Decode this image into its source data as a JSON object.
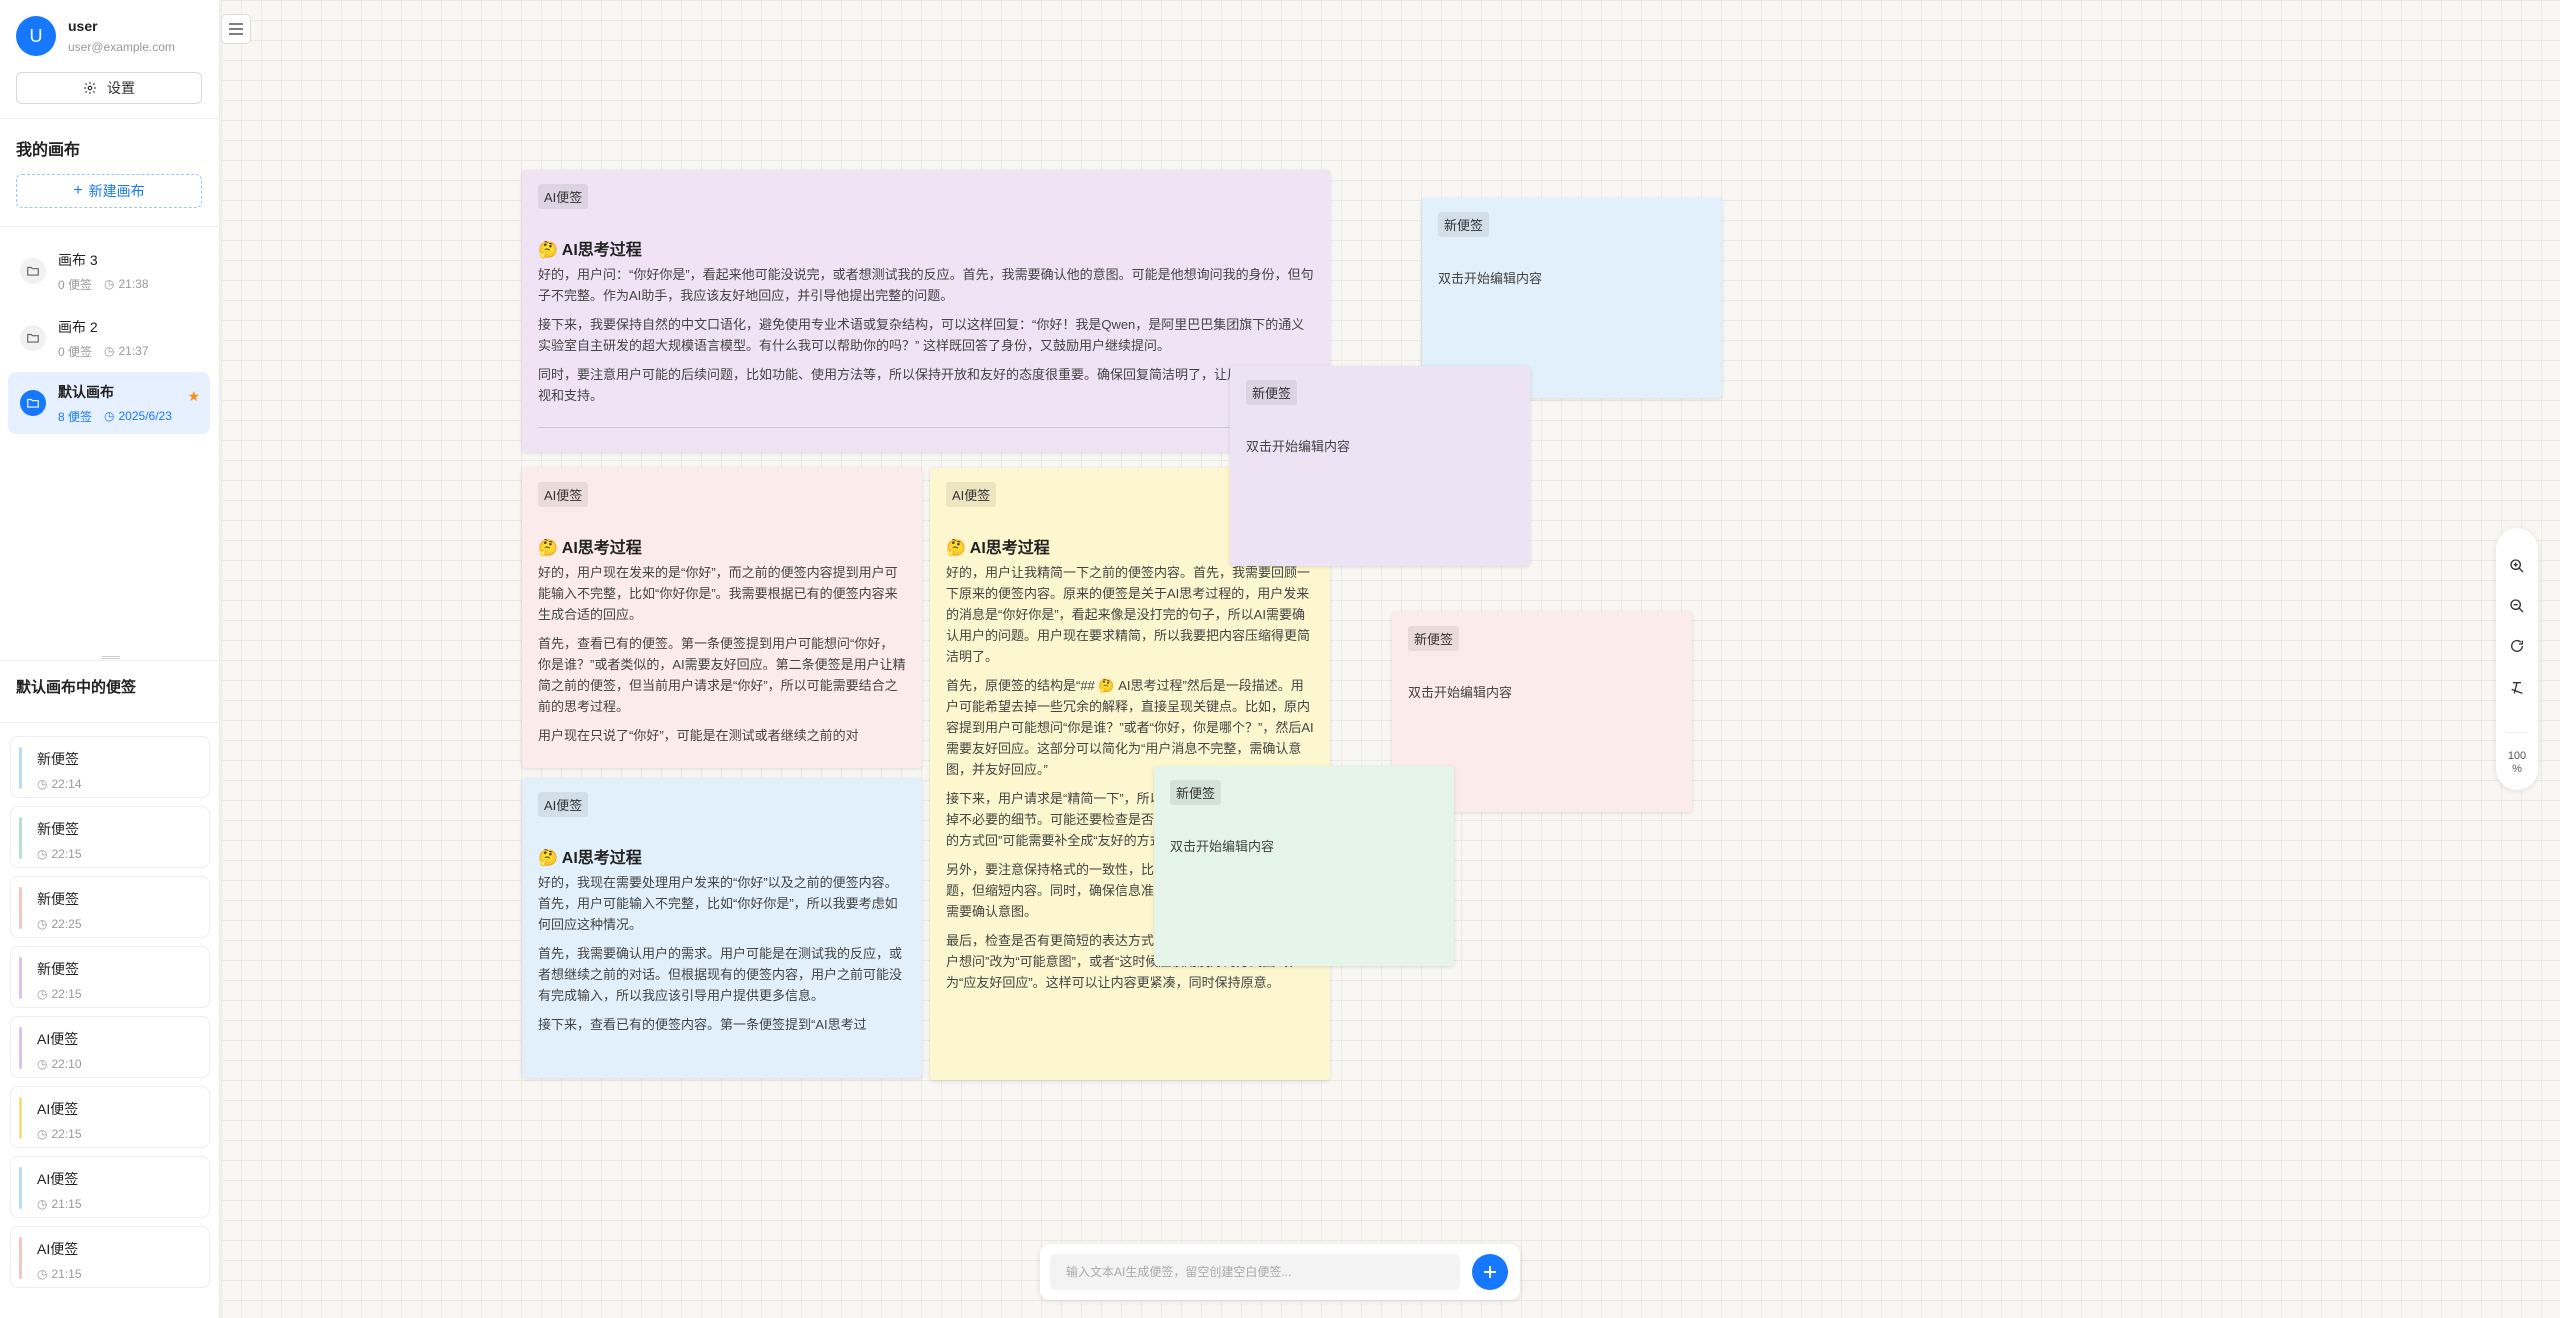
{
  "user": {
    "avatar": "U",
    "name": "user",
    "email": "user@example.com"
  },
  "sidebar": {
    "settings_label": "设置",
    "my_canvases_title": "我的画布",
    "new_canvas_label": "新建画布",
    "canvases": [
      {
        "title": "画布 3",
        "count": "0 便签",
        "time": "21:38",
        "active": false,
        "starred": false
      },
      {
        "title": "画布 2",
        "count": "0 便签",
        "time": "21:37",
        "active": false,
        "starred": false
      },
      {
        "title": "默认画布",
        "count": "8 便签",
        "time": "2025/6/23",
        "active": true,
        "starred": true
      }
    ],
    "notes_title": "默认画布中的便签",
    "notes": [
      {
        "title": "新便签",
        "time": "22:14",
        "color": "#b8dcf5"
      },
      {
        "title": "新便签",
        "time": "22:15",
        "color": "#b7e4c7"
      },
      {
        "title": "新便签",
        "time": "22:25",
        "color": "#f5c6c6"
      },
      {
        "title": "新便签",
        "time": "22:15",
        "color": "#d9c2ef"
      },
      {
        "title": "AI便签",
        "time": "22:10",
        "color": "#d9c2ef"
      },
      {
        "title": "AI便签",
        "time": "22:15",
        "color": "#f5e08a"
      },
      {
        "title": "AI便签",
        "time": "21:15",
        "color": "#b8dcf5"
      },
      {
        "title": "AI便签",
        "time": "21:15",
        "color": "#f5c6c6"
      }
    ]
  },
  "canvas": {
    "notes": [
      {
        "tag": "AI便签",
        "heading": "🤔 AI思考过程",
        "color": "#efe3f5",
        "paragraphs": [
          "好的，用户问：“你好你是”，看起来他可能没说完，或者想测试我的反应。首先，我需要确认他的意图。可能是他想询问我的身份，但句子不完整。作为AI助手，我应该友好地回应，并引导他提出完整的问题。",
          "接下来，我要保持自然的中文口语化，避免使用专业术语或复杂结构，可以这样回复：“你好！我是Qwen，是阿里巴巴集团旗下的通义实验室自主研发的超大规模语言模型。有什么我可以帮助你的吗？” 这样既回答了身份，又鼓励用户继续提问。",
          "同时，要注意用户可能的后续问题，比如功能、使用方法等，所以保持开放和友好的态度很重要。确保回复简洁明了，让用户感到被重视和支持。"
        ]
      },
      {
        "tag": "AI便签",
        "heading": "🤔 AI思考过程",
        "color": "#fcebeb",
        "paragraphs": [
          "好的，用户现在发来的是“你好”，而之前的便签内容提到用户可能输入不完整，比如“你好你是”。我需要根据已有的便签内容来生成合适的回应。",
          "首先，查看已有的便签。第一条便签提到用户可能想问“你好，你是谁？”或者类似的，AI需要友好回应。第二条便签是用户让精简之前的便签，但当前用户请求是“你好”，所以可能需要结合之前的思考过程。",
          "用户现在只说了“你好”，可能是在测试或者继续之前的对"
        ]
      },
      {
        "tag": "AI便签",
        "heading": "🤔 AI思考过程",
        "color": "#fdf7cf",
        "paragraphs": [
          "好的，用户让我精简一下之前的便签内容。首先，我需要回顾一下原来的便签内容。原来的便签是关于AI思考过程的，用户发来的消息是“你好你是”，看起来像是没打完的句子，所以AI需要确认用户的问题。用户现在要求精简，所以我要把内容压缩得更简洁明了。",
          "首先，原便签的结构是“## 🤔 AI思考过程”然后是一段描述。用户可能希望去掉一些冗余的解释，直接呈现关键点。比如，原内容提到用户可能想问“你是谁？”或者“你好，你是哪个？”，然后AI需要友好回应。这部分可以简化为“用户消息不完整，需确认意图，并友好回应。”",
          "接下来，用户请求是“精简一下”，所以我需要保持核心信息，去掉不必要的细节。可能还要检查是否有重复的部分，比如“友好的方式回”可能需要补全成“友好的方式回复”。",
          "另外，要注意保持格式的一致性，比如使用二级标题和正确的标题，但缩短内容。同时，确保信息准确，比如用户消息不完整，需要确认意图。",
          "最后，检查是否有更简短的表达方式，比如将“可能的情况是用户想问”改为“可能意图”，或者“这时候应该用友好的方式回”改为“应友好回应”。这样可以让内容更紧凑，同时保持原意。"
        ]
      },
      {
        "tag": "AI便签",
        "heading": "🤔 AI思考过程",
        "color": "#e2f0fb",
        "paragraphs": [
          "好的，我现在需要处理用户发来的“你好”以及之前的便签内容。首先，用户可能输入不完整，比如“你好你是”，所以我要考虑如何回应这种情况。",
          "首先，我需要确认用户的需求。用户可能是在测试我的反应，或者想继续之前的对话。但根据现有的便签内容，用户之前可能没有完成输入，所以我应该引导用户提供更多信息。",
          "接下来，查看已有的便签内容。第一条便签提到“AI思考过"
        ]
      },
      {
        "tag": "新便签",
        "placeholder": "双击开始编辑内容",
        "color": "#e2f0fb"
      },
      {
        "tag": "新便签",
        "placeholder": "双击开始编辑内容",
        "color": "#ede3f5"
      },
      {
        "tag": "新便签",
        "placeholder": "双击开始编辑内容",
        "color": "#fcebeb"
      },
      {
        "tag": "新便签",
        "placeholder": "双击开始编辑内容",
        "color": "#e5f5ea"
      }
    ]
  },
  "zoom": {
    "level": "100",
    "unit": "%"
  },
  "input": {
    "placeholder": "输入文本AI生成便签，留空创建空白便签..."
  },
  "icons": {
    "settings": "gear-icon",
    "folder": "folder-icon",
    "clock": "clock-icon",
    "star": "star-icon",
    "menu": "menu-icon",
    "zoom_in": "zoom-in-icon",
    "zoom_out": "zoom-out-icon",
    "reset": "reset-icon",
    "clear": "clear-format-icon",
    "add": "plus-icon"
  },
  "colors": {
    "accent": "#1677ff",
    "star": "#fa8c16"
  }
}
